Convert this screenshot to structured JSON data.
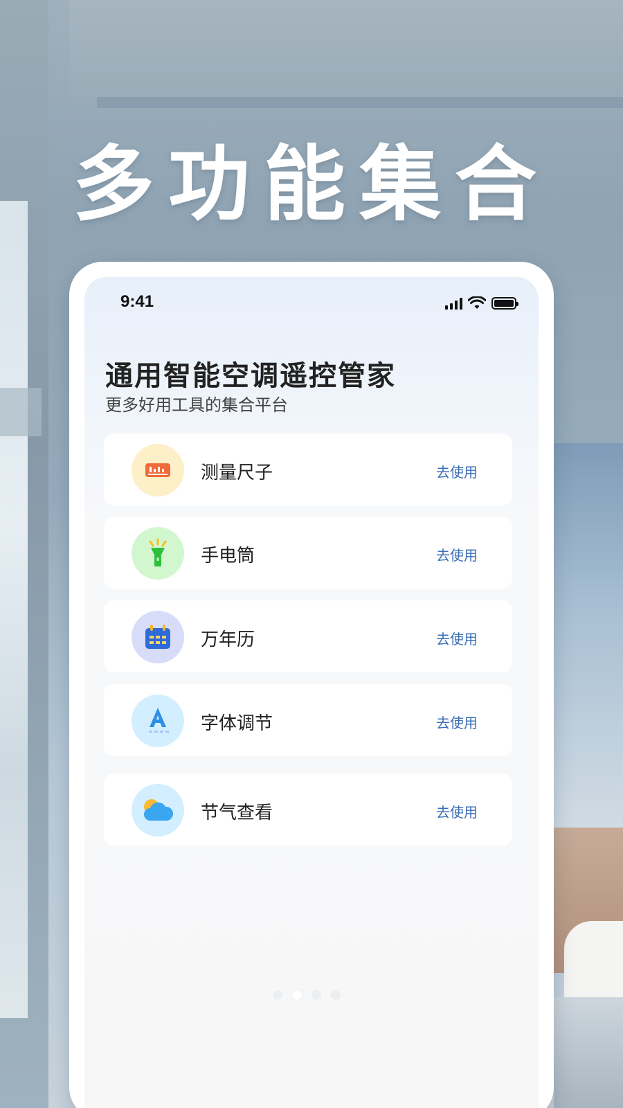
{
  "hero": {
    "title": "多功能集合"
  },
  "status_bar": {
    "time": "9:41"
  },
  "app": {
    "title": "通用智能空调遥控管家",
    "subtitle": "更多好用工具的集合平台"
  },
  "tools": [
    {
      "label": "测量尺子",
      "action": "去使用",
      "icon": "ruler-icon",
      "icon_bg": "#fdf0c8",
      "icon_color": "#f06b3a"
    },
    {
      "label": "手电筒",
      "action": "去使用",
      "icon": "flashlight-icon",
      "icon_bg": "#d2f7cf",
      "icon_color": "#2dbf3c"
    },
    {
      "label": "万年历",
      "action": "去使用",
      "icon": "calendar-icon",
      "icon_bg": "#d7dcf8",
      "icon_color": "#2e6bd9"
    },
    {
      "label": "字体调节",
      "action": "去使用",
      "icon": "font-size-icon",
      "icon_bg": "#d3efff",
      "icon_color": "#2f8fe6"
    },
    {
      "label": "节气查看",
      "action": "去使用",
      "icon": "weather-icon",
      "icon_bg": "#d3efff",
      "icon_color": "#3aa6f0"
    }
  ],
  "pagination": {
    "pages": 4,
    "active": 2
  }
}
